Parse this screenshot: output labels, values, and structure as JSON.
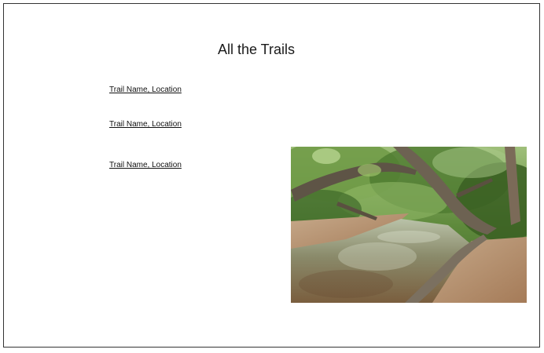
{
  "page": {
    "title": "All the Trails"
  },
  "trails": [
    {
      "label": "Trail Name, Location"
    },
    {
      "label": "Trail Name, Location"
    },
    {
      "label": "Trail Name, Location"
    }
  ],
  "colors": {
    "border": "#333333",
    "text": "#111111",
    "background": "#ffffff"
  }
}
